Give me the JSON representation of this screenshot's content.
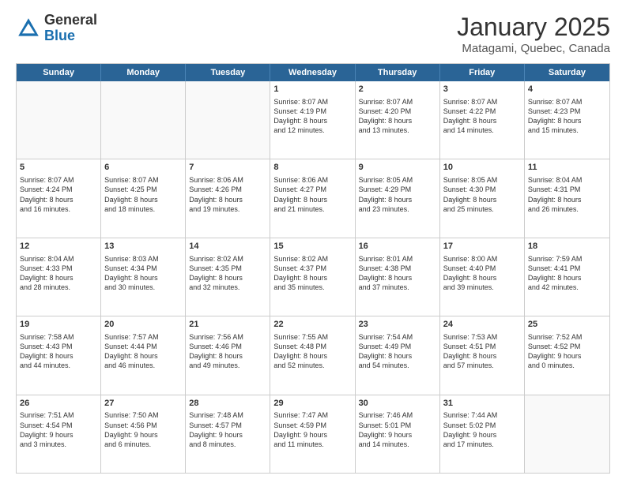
{
  "header": {
    "logo_general": "General",
    "logo_blue": "Blue",
    "month_title": "January 2025",
    "subtitle": "Matagami, Quebec, Canada"
  },
  "weekdays": [
    "Sunday",
    "Monday",
    "Tuesday",
    "Wednesday",
    "Thursday",
    "Friday",
    "Saturday"
  ],
  "rows": [
    [
      {
        "day": "",
        "lines": [],
        "empty": true
      },
      {
        "day": "",
        "lines": [],
        "empty": true
      },
      {
        "day": "",
        "lines": [],
        "empty": true
      },
      {
        "day": "1",
        "lines": [
          "Sunrise: 8:07 AM",
          "Sunset: 4:19 PM",
          "Daylight: 8 hours",
          "and 12 minutes."
        ],
        "empty": false
      },
      {
        "day": "2",
        "lines": [
          "Sunrise: 8:07 AM",
          "Sunset: 4:20 PM",
          "Daylight: 8 hours",
          "and 13 minutes."
        ],
        "empty": false
      },
      {
        "day": "3",
        "lines": [
          "Sunrise: 8:07 AM",
          "Sunset: 4:22 PM",
          "Daylight: 8 hours",
          "and 14 minutes."
        ],
        "empty": false
      },
      {
        "day": "4",
        "lines": [
          "Sunrise: 8:07 AM",
          "Sunset: 4:23 PM",
          "Daylight: 8 hours",
          "and 15 minutes."
        ],
        "empty": false
      }
    ],
    [
      {
        "day": "5",
        "lines": [
          "Sunrise: 8:07 AM",
          "Sunset: 4:24 PM",
          "Daylight: 8 hours",
          "and 16 minutes."
        ],
        "empty": false
      },
      {
        "day": "6",
        "lines": [
          "Sunrise: 8:07 AM",
          "Sunset: 4:25 PM",
          "Daylight: 8 hours",
          "and 18 minutes."
        ],
        "empty": false
      },
      {
        "day": "7",
        "lines": [
          "Sunrise: 8:06 AM",
          "Sunset: 4:26 PM",
          "Daylight: 8 hours",
          "and 19 minutes."
        ],
        "empty": false
      },
      {
        "day": "8",
        "lines": [
          "Sunrise: 8:06 AM",
          "Sunset: 4:27 PM",
          "Daylight: 8 hours",
          "and 21 minutes."
        ],
        "empty": false
      },
      {
        "day": "9",
        "lines": [
          "Sunrise: 8:05 AM",
          "Sunset: 4:29 PM",
          "Daylight: 8 hours",
          "and 23 minutes."
        ],
        "empty": false
      },
      {
        "day": "10",
        "lines": [
          "Sunrise: 8:05 AM",
          "Sunset: 4:30 PM",
          "Daylight: 8 hours",
          "and 25 minutes."
        ],
        "empty": false
      },
      {
        "day": "11",
        "lines": [
          "Sunrise: 8:04 AM",
          "Sunset: 4:31 PM",
          "Daylight: 8 hours",
          "and 26 minutes."
        ],
        "empty": false
      }
    ],
    [
      {
        "day": "12",
        "lines": [
          "Sunrise: 8:04 AM",
          "Sunset: 4:33 PM",
          "Daylight: 8 hours",
          "and 28 minutes."
        ],
        "empty": false
      },
      {
        "day": "13",
        "lines": [
          "Sunrise: 8:03 AM",
          "Sunset: 4:34 PM",
          "Daylight: 8 hours",
          "and 30 minutes."
        ],
        "empty": false
      },
      {
        "day": "14",
        "lines": [
          "Sunrise: 8:02 AM",
          "Sunset: 4:35 PM",
          "Daylight: 8 hours",
          "and 32 minutes."
        ],
        "empty": false
      },
      {
        "day": "15",
        "lines": [
          "Sunrise: 8:02 AM",
          "Sunset: 4:37 PM",
          "Daylight: 8 hours",
          "and 35 minutes."
        ],
        "empty": false
      },
      {
        "day": "16",
        "lines": [
          "Sunrise: 8:01 AM",
          "Sunset: 4:38 PM",
          "Daylight: 8 hours",
          "and 37 minutes."
        ],
        "empty": false
      },
      {
        "day": "17",
        "lines": [
          "Sunrise: 8:00 AM",
          "Sunset: 4:40 PM",
          "Daylight: 8 hours",
          "and 39 minutes."
        ],
        "empty": false
      },
      {
        "day": "18",
        "lines": [
          "Sunrise: 7:59 AM",
          "Sunset: 4:41 PM",
          "Daylight: 8 hours",
          "and 42 minutes."
        ],
        "empty": false
      }
    ],
    [
      {
        "day": "19",
        "lines": [
          "Sunrise: 7:58 AM",
          "Sunset: 4:43 PM",
          "Daylight: 8 hours",
          "and 44 minutes."
        ],
        "empty": false
      },
      {
        "day": "20",
        "lines": [
          "Sunrise: 7:57 AM",
          "Sunset: 4:44 PM",
          "Daylight: 8 hours",
          "and 46 minutes."
        ],
        "empty": false
      },
      {
        "day": "21",
        "lines": [
          "Sunrise: 7:56 AM",
          "Sunset: 4:46 PM",
          "Daylight: 8 hours",
          "and 49 minutes."
        ],
        "empty": false
      },
      {
        "day": "22",
        "lines": [
          "Sunrise: 7:55 AM",
          "Sunset: 4:48 PM",
          "Daylight: 8 hours",
          "and 52 minutes."
        ],
        "empty": false
      },
      {
        "day": "23",
        "lines": [
          "Sunrise: 7:54 AM",
          "Sunset: 4:49 PM",
          "Daylight: 8 hours",
          "and 54 minutes."
        ],
        "empty": false
      },
      {
        "day": "24",
        "lines": [
          "Sunrise: 7:53 AM",
          "Sunset: 4:51 PM",
          "Daylight: 8 hours",
          "and 57 minutes."
        ],
        "empty": false
      },
      {
        "day": "25",
        "lines": [
          "Sunrise: 7:52 AM",
          "Sunset: 4:52 PM",
          "Daylight: 9 hours",
          "and 0 minutes."
        ],
        "empty": false
      }
    ],
    [
      {
        "day": "26",
        "lines": [
          "Sunrise: 7:51 AM",
          "Sunset: 4:54 PM",
          "Daylight: 9 hours",
          "and 3 minutes."
        ],
        "empty": false
      },
      {
        "day": "27",
        "lines": [
          "Sunrise: 7:50 AM",
          "Sunset: 4:56 PM",
          "Daylight: 9 hours",
          "and 6 minutes."
        ],
        "empty": false
      },
      {
        "day": "28",
        "lines": [
          "Sunrise: 7:48 AM",
          "Sunset: 4:57 PM",
          "Daylight: 9 hours",
          "and 8 minutes."
        ],
        "empty": false
      },
      {
        "day": "29",
        "lines": [
          "Sunrise: 7:47 AM",
          "Sunset: 4:59 PM",
          "Daylight: 9 hours",
          "and 11 minutes."
        ],
        "empty": false
      },
      {
        "day": "30",
        "lines": [
          "Sunrise: 7:46 AM",
          "Sunset: 5:01 PM",
          "Daylight: 9 hours",
          "and 14 minutes."
        ],
        "empty": false
      },
      {
        "day": "31",
        "lines": [
          "Sunrise: 7:44 AM",
          "Sunset: 5:02 PM",
          "Daylight: 9 hours",
          "and 17 minutes."
        ],
        "empty": false
      },
      {
        "day": "",
        "lines": [],
        "empty": true
      }
    ]
  ]
}
